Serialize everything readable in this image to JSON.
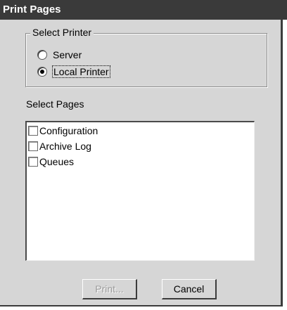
{
  "window": {
    "title": "Print Pages"
  },
  "select_printer": {
    "legend": "Select Printer",
    "options": [
      {
        "label": "Server",
        "checked": false
      },
      {
        "label": "Local Printer",
        "checked": true
      }
    ]
  },
  "select_pages": {
    "label": "Select Pages",
    "items": [
      {
        "label": "Configuration",
        "checked": false
      },
      {
        "label": "Archive Log",
        "checked": false
      },
      {
        "label": "Queues",
        "checked": false
      }
    ]
  },
  "buttons": {
    "print_label": "Print...",
    "print_enabled": false,
    "cancel_label": "Cancel"
  }
}
